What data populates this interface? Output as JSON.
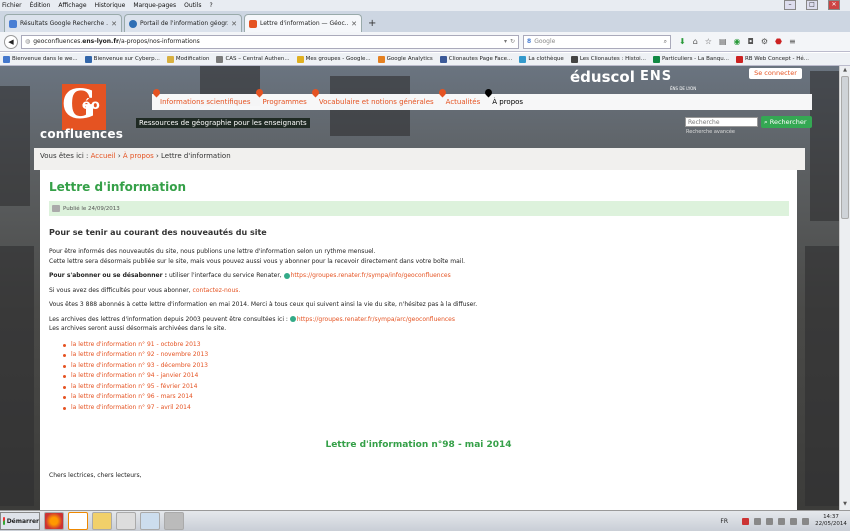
{
  "menu": [
    "Fichier",
    "Édition",
    "Affichage",
    "Historique",
    "Marque-pages",
    "Outils",
    "?"
  ],
  "tabs": [
    {
      "label": "Résultats Google Recherche ...",
      "color": "#4a7fd4"
    },
    {
      "label": "Portail de l'information géogr...",
      "color": "#2f6fb5"
    },
    {
      "label": "Lettre d'information — Géoc...",
      "color": "#e55322"
    }
  ],
  "newtab": "+",
  "url": {
    "prefix": "geoconfluences.",
    "domain": "ens-lyon.fr",
    "path": "/a-propos/nos-informations"
  },
  "search_placeholder": "Google",
  "bookmarks": [
    {
      "label": "Bienvenue dans le we...",
      "color": "#4477cc"
    },
    {
      "label": "Bienvenue sur Cyberp...",
      "color": "#3366aa"
    },
    {
      "label": "Modification",
      "color": "#d8b040"
    },
    {
      "label": "CAS – Central Authen...",
      "color": "#7a7a7a"
    },
    {
      "label": "Mes groupes - Google...",
      "color": "#e0b020"
    },
    {
      "label": "Google Analytics",
      "color": "#e58020"
    },
    {
      "label": "Clionautes Page Face...",
      "color": "#3b5998"
    },
    {
      "label": "La clothèque",
      "color": "#3399cc"
    },
    {
      "label": "Les Clionautes : Histoi...",
      "color": "#444"
    },
    {
      "label": "Particuliers - La Banqu...",
      "color": "#118844"
    },
    {
      "label": "RB Web Concept - Hé...",
      "color": "#cc2222"
    }
  ],
  "site": {
    "logo": {
      "g": "G",
      "eo": "éo",
      "conf": "confluences"
    },
    "tagline": "Ressources de géographie pour les enseignants",
    "nav": [
      "Informations scientifiques",
      "Programmes",
      "Vocabulaire et notions générales",
      "Actualités",
      "À propos"
    ],
    "eduscol": "éduscol",
    "ens": "ENS",
    "ens_sub": "ÉNS DE LYON",
    "connect": "Se connecter",
    "search_placeholder": "Recherche",
    "search_button": "Rechercher",
    "search_advanced": "Recherche avancée"
  },
  "breadcrumb": {
    "prefix": "Vous êtes ici :",
    "home": "Accueil",
    "sep1": "›",
    "apropos": "À propos",
    "sep2": "›",
    "current": "Lettre d'information"
  },
  "page": {
    "title": "Lettre d'information",
    "published": "Publié le 24/09/2013",
    "h2": "Pour se tenir au courant des nouveautés du site",
    "p1a": "Pour être informés des nouveautés du site, nous publions une lettre d'information selon un rythme mensuel.",
    "p1b": "Cette lettre sera désormais publiée sur le site, mais vous pouvez aussi vous y abonner pour la recevoir directement dans votre boîte mail.",
    "p2_bold": "Pour s'abonner ou se désabonner :",
    "p2_text": " utiliser l'interface du service Renater,",
    "p2_link": "https://groupes.renater.fr/sympa/info/geoconfluences",
    "p3_text": "Si vous avez des difficultés pour vous abonner,",
    "p3_link": "contactez-nous.",
    "p4": "Vous êtes 3 888 abonnés à cette lettre d'information en mai 2014. Merci à tous ceux qui suivent ainsi la vie du site, n'hésitez pas à la diffuser.",
    "p5_text": "Les archives des lettres d'information depuis 2003 peuvent être consultées ici :",
    "p5_link": "https://groupes.renater.fr/sympa/arc/geoconfluences",
    "p5b": "Les archives seront aussi désormais archivées dans le site.",
    "letters": [
      "la lettre d'information n° 91 - octobre 2013",
      "la lettre d'information n° 92 - novembre 2013",
      "la lettre d'information n° 93 - décembre 2013",
      "la lettre d'information n° 94 - janvier 2014",
      "la lettre d'information n° 95 - février 2014",
      "la lettre d'information n° 96 - mars 2014",
      "la lettre d'information n° 97 - avril 2014"
    ],
    "newsletter_title": "Lettre d'information n°98 - mai 2014",
    "salutation": "Chers lectrices, chers lecteurs,"
  },
  "taskbar": {
    "start": "Démarrer",
    "lang": "FR",
    "time": "14:37",
    "date": "22/05/2014"
  }
}
